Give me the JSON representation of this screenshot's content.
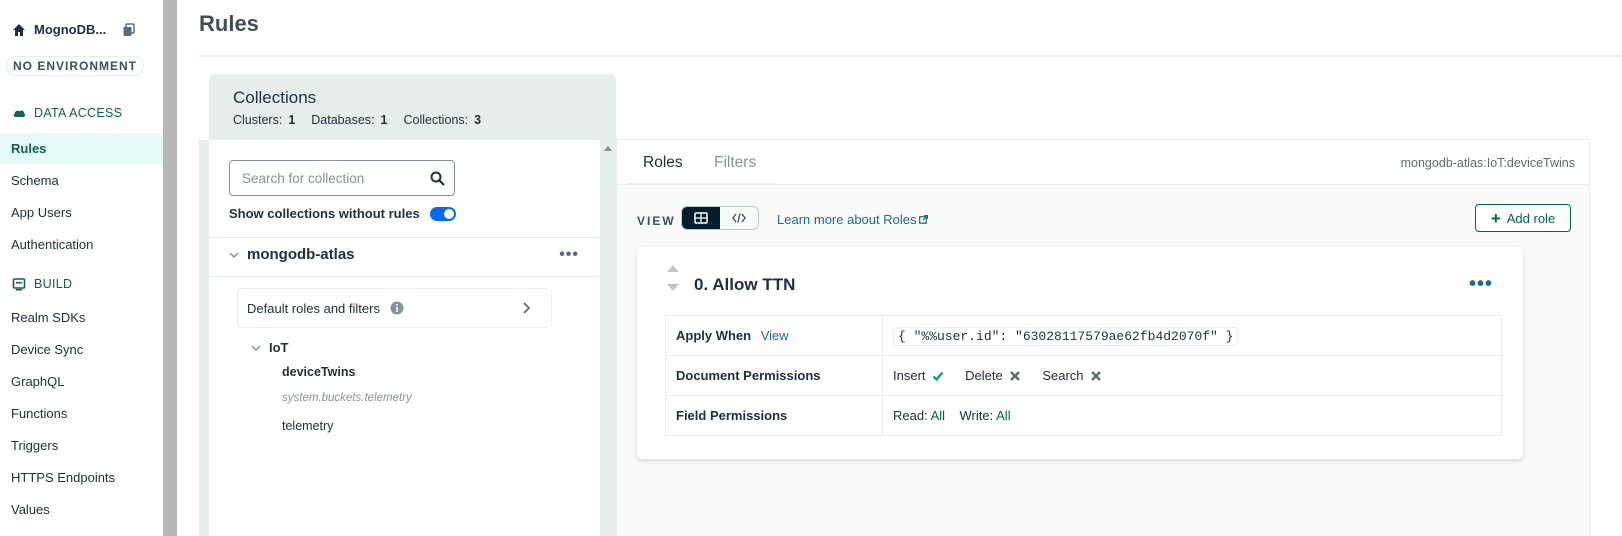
{
  "sidebar": {
    "app_name": "MognoDB...",
    "environment": "NO ENVIRONMENT",
    "sections": [
      {
        "title": "DATA ACCESS",
        "items": [
          "Rules",
          "Schema",
          "App Users",
          "Authentication"
        ]
      },
      {
        "title": "BUILD",
        "items": [
          "Realm SDKs",
          "Device Sync",
          "GraphQL",
          "Functions",
          "Triggers",
          "HTTPS Endpoints",
          "Values"
        ]
      }
    ],
    "active_item": "Rules"
  },
  "page": {
    "title": "Rules"
  },
  "collections": {
    "title": "Collections",
    "stats": {
      "clusters_label": "Clusters:",
      "clusters": "1",
      "databases_label": "Databases:",
      "databases": "1",
      "collections_label": "Collections:",
      "collections": "3"
    },
    "search_placeholder": "Search for collection",
    "toggle_label": "Show collections without rules",
    "toggle_on": true,
    "cluster": {
      "name": "mongodb-atlas",
      "menu": "•••",
      "default_label": "Default roles and filters",
      "database": {
        "name": "IoT",
        "items": [
          {
            "name": "deviceTwins",
            "selected": true
          },
          {
            "name": "system.buckets.telemetry",
            "system": true
          },
          {
            "name": "telemetry"
          }
        ]
      }
    }
  },
  "rules_panel": {
    "tabs": [
      "Roles",
      "Filters"
    ],
    "active_tab": "Roles",
    "namespace": "mongodb-atlas:IoT:deviceTwins",
    "view_label": "VIEW",
    "learn_more": "Learn more about Roles",
    "add_role": "Add role",
    "role": {
      "name": "0. Allow TTN",
      "menu": "•••",
      "apply_when_label": "Apply When",
      "apply_when_link": "View",
      "apply_when_value": "{ \"%%user.id\": \"63028117579ae62fb4d2070f\" }",
      "document_permissions_label": "Document Permissions",
      "document_permissions": [
        {
          "name": "Insert",
          "allowed": true
        },
        {
          "name": "Delete",
          "allowed": false
        },
        {
          "name": "Search",
          "allowed": false
        }
      ],
      "field_permissions_label": "Field Permissions",
      "read_label": "Read:",
      "read_value": "All",
      "write_label": "Write:",
      "write_value": "All"
    }
  },
  "colors": {
    "accent_green": "#00684a",
    "active_nav_bg": "#e3fcf7",
    "link_blue": "#1a6b8c",
    "toggle_blue": "#016bf8"
  }
}
